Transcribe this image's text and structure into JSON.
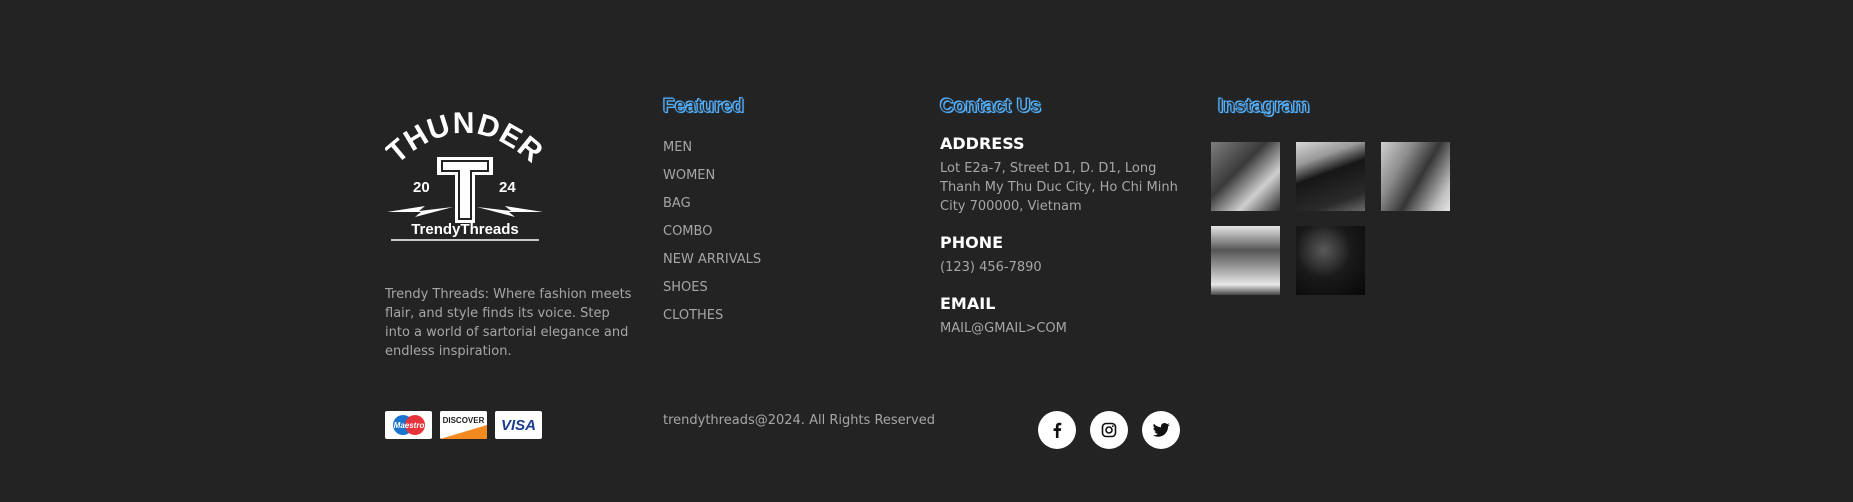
{
  "brand": {
    "logo_top_text": "THUNDER",
    "logo_left_year": "20",
    "logo_right_year": "24",
    "logo_bottom_text": "TrendyThreads",
    "about": "Trendy Threads: Where fashion meets flair, and style finds its voice. Step into a world of sartorial elegance and endless inspiration."
  },
  "featured": {
    "title": "Featured",
    "items": [
      "MEN",
      "WOMEN",
      "BAG",
      "COMBO",
      "NEW ARRIVALS",
      "SHOES",
      "CLOTHES"
    ]
  },
  "contact": {
    "title": "Contact Us",
    "address_label": "ADDRESS",
    "address": "Lot E2a-7, Street D1, D. D1, Long Thanh My Thu Duc City, Ho Chi Minh City 700000, Vietnam",
    "phone_label": "PHONE",
    "phone": "(123) 456-7890",
    "email_label": "EMAIL",
    "email": "MAIL@GMAIL>COM"
  },
  "instagram": {
    "title": "Instagram",
    "photos": [
      "instagram-photo-watch",
      "instagram-photo-bag",
      "instagram-photo-shoes",
      "instagram-photo-street",
      "instagram-photo-cap"
    ]
  },
  "footer": {
    "payments": [
      "Maestro",
      "DISCOVER",
      "VISA"
    ],
    "copyright": "trendythreads@2024. All Rights Reserved",
    "social": [
      "facebook-icon",
      "instagram-icon",
      "twitter-icon"
    ]
  },
  "colors": {
    "background": "#232323",
    "title_accent": "#58b4ff"
  }
}
